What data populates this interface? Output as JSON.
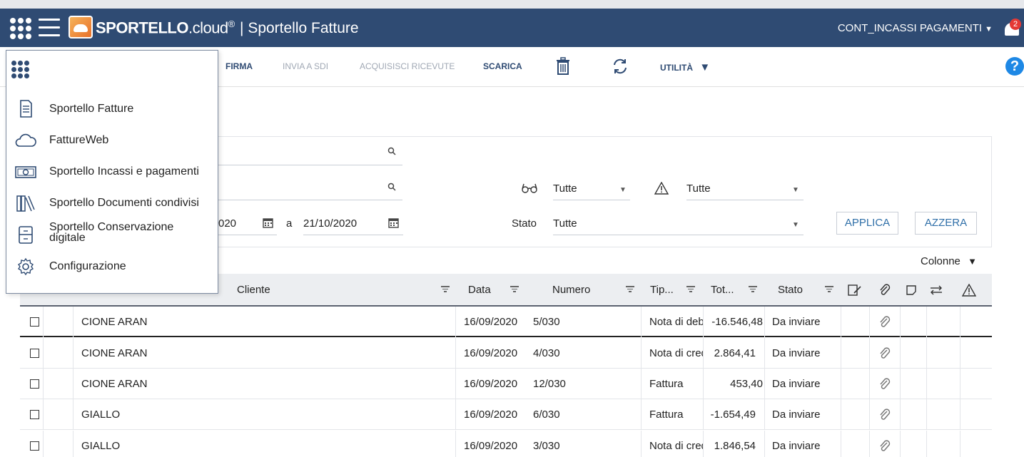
{
  "header": {
    "brand_main": "SPORTELLO",
    "brand_domain": ".cloud",
    "brand_reg": "®",
    "separator": "|",
    "app_title": "Sportello Fatture",
    "user": "CONT_INCASSI PAGAMENTI",
    "notification_count": "2",
    "colors": {
      "bar": "#2f4b73",
      "badge": "#e53935",
      "help": "#1e88e5"
    }
  },
  "toolbar": {
    "firma": "FIRMA",
    "invia_sdi": "INVIA A SDI",
    "acquisisci": "ACQUISISCI RICEVUTE",
    "scarica": "SCARICA",
    "utilita": "UTILITÀ",
    "help": "?"
  },
  "menu": {
    "items": [
      {
        "label": "Sportello Fatture",
        "icon": "document-icon"
      },
      {
        "label": "FattureWeb",
        "icon": "cloud-icon"
      },
      {
        "label": "Sportello Incassi e pagamenti",
        "icon": "banknote-icon"
      },
      {
        "label": "Sportello Documenti condivisi",
        "icon": "library-icon"
      },
      {
        "label": "Sportello Conservazione digitale",
        "icon": "archive-icon"
      },
      {
        "label": "Configurazione",
        "icon": "gear-icon"
      }
    ]
  },
  "filters": {
    "date_from_partial": "020",
    "date_sep": "a",
    "date_to": "21/10/2020",
    "read_value": "Tutte",
    "warning_value": "Tutte",
    "stato_label": "Stato",
    "stato_value": "Tutte",
    "applica": "APPLICA",
    "azzera": "AZZERA",
    "colonne": "Colonne"
  },
  "table": {
    "headers": {
      "cliente": "Cliente",
      "data": "Data",
      "numero": "Numero",
      "tipo": "Tip...",
      "totale": "Tot...",
      "stato": "Stato"
    },
    "rows": [
      {
        "cliente": "CIONE ARAN",
        "data": "16/09/2020",
        "numero": "5/030",
        "tipo": "Nota di debito",
        "totale": "-16.546,48",
        "stato": "Da inviare"
      },
      {
        "cliente": "CIONE ARAN",
        "data": "16/09/2020",
        "numero": "4/030",
        "tipo": "Nota di credito",
        "totale": "2.864,41",
        "stato": "Da inviare"
      },
      {
        "cliente": "CIONE ARAN",
        "data": "16/09/2020",
        "numero": "12/030",
        "tipo": "Fattura",
        "totale": "453,40",
        "stato": "Da inviare"
      },
      {
        "cliente": "GIALLO",
        "data": "16/09/2020",
        "numero": "6/030",
        "tipo": "Fattura",
        "totale": "-1.654,49",
        "stato": "Da inviare"
      },
      {
        "cliente": "GIALLO",
        "data": "16/09/2020",
        "numero": "3/030",
        "tipo": "Nota di credito",
        "totale": "1.846,54",
        "stato": "Da inviare"
      }
    ]
  }
}
